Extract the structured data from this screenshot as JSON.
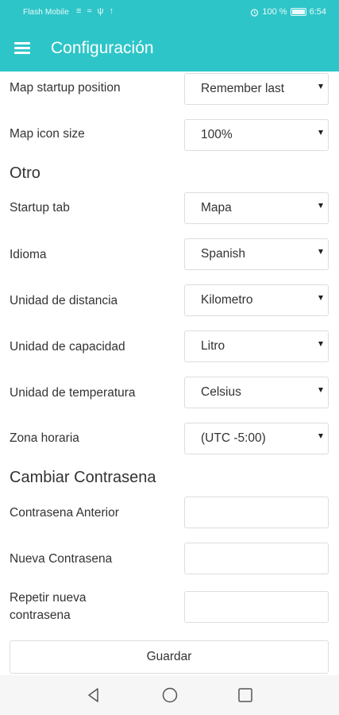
{
  "status_bar": {
    "carrier": "Flash Mobile",
    "sys_icons": "≡ ≈ ψ ↑",
    "battery": "100 %",
    "time": "6:54"
  },
  "app_bar": {
    "title": "Configuración"
  },
  "settings_top": [
    {
      "label": "Map startup position",
      "value": "Remember last"
    },
    {
      "label": "Map icon size",
      "value": "100%"
    }
  ],
  "section_other": {
    "title": "Otro",
    "items": [
      {
        "label": "Startup tab",
        "value": "Mapa"
      },
      {
        "label": "Idioma",
        "value": "Spanish"
      },
      {
        "label": "Unidad de distancia",
        "value": "Kilometro"
      },
      {
        "label": "Unidad de capacidad",
        "value": "Litro"
      },
      {
        "label": "Unidad de temperatura",
        "value": "Celsius"
      },
      {
        "label": "Zona horaria",
        "value": "(UTC -5:00)"
      }
    ]
  },
  "section_password": {
    "title": "Cambiar Contrasena",
    "fields": [
      {
        "label": "Contrasena Anterior",
        "value": ""
      },
      {
        "label": "Nueva Contrasena",
        "value": ""
      },
      {
        "label_line1": "Repetir nueva",
        "label_line2": "contrasena",
        "value": ""
      }
    ]
  },
  "save_label": "Guardar",
  "colors": {
    "primary": "#2ec5c8",
    "border": "#dddddd",
    "text": "#333333"
  }
}
